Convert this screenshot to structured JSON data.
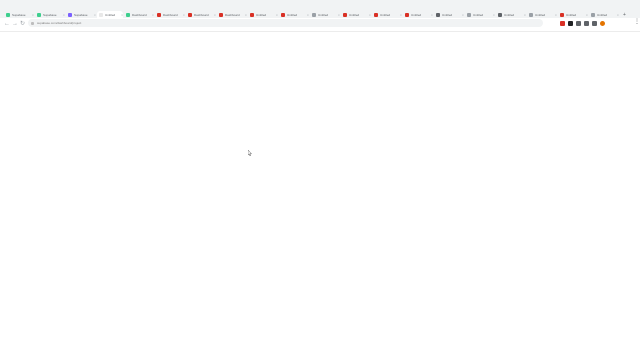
{
  "tabs": [
    {
      "label": "Supabase",
      "favicon_color": "#3ecf8e"
    },
    {
      "label": "Supabase",
      "favicon_color": "#3ecf8e"
    },
    {
      "label": "Supabase",
      "favicon_color": "#7b61ff"
    },
    {
      "label": "Untitled",
      "favicon_color": "#e8e8e8",
      "active": true
    },
    {
      "label": "Dashboard",
      "favicon_color": "#3ecf8e"
    },
    {
      "label": "Dashboard",
      "favicon_color": "#d93025"
    },
    {
      "label": "Dashboard",
      "favicon_color": "#d93025"
    },
    {
      "label": "Dashboard",
      "favicon_color": "#d93025"
    },
    {
      "label": "Untitled",
      "favicon_color": "#d93025"
    },
    {
      "label": "Untitled",
      "favicon_color": "#d93025"
    },
    {
      "label": "Untitled",
      "favicon_color": "#9aa0a6"
    },
    {
      "label": "Untitled",
      "favicon_color": "#d93025"
    },
    {
      "label": "Untitled",
      "favicon_color": "#d93025"
    },
    {
      "label": "Untitled",
      "favicon_color": "#d93025"
    },
    {
      "label": "Untitled",
      "favicon_color": "#5f6368"
    },
    {
      "label": "Untitled",
      "favicon_color": "#9aa0a6"
    },
    {
      "label": "Untitled",
      "favicon_color": "#5f6368"
    },
    {
      "label": "Untitled",
      "favicon_color": "#9aa0a6"
    },
    {
      "label": "Untitled",
      "favicon_color": "#d93025"
    },
    {
      "label": "Untitled",
      "favicon_color": "#9aa0a6"
    }
  ],
  "toolbar": {
    "back_icon": "arrow-left-icon",
    "forward_icon": "arrow-right-icon",
    "reload_icon": "reload-icon",
    "url": "supabase.com/dashboard/project"
  },
  "extensions": [
    {
      "name": "extension-red-icon",
      "color": "#d93025"
    },
    {
      "name": "extension-dark-icon",
      "color": "#202124"
    },
    {
      "name": "extension-grey-icon",
      "color": "#5f6368"
    },
    {
      "name": "extension-puzzle-icon",
      "color": "#5f6368"
    },
    {
      "name": "extension-box-icon",
      "color": "#5f6368"
    },
    {
      "name": "profile-avatar",
      "color": "#e37400",
      "round": true
    }
  ],
  "colors": {
    "tabstrip_bg": "#f1f3f4",
    "page_bg": "#ffffff"
  }
}
